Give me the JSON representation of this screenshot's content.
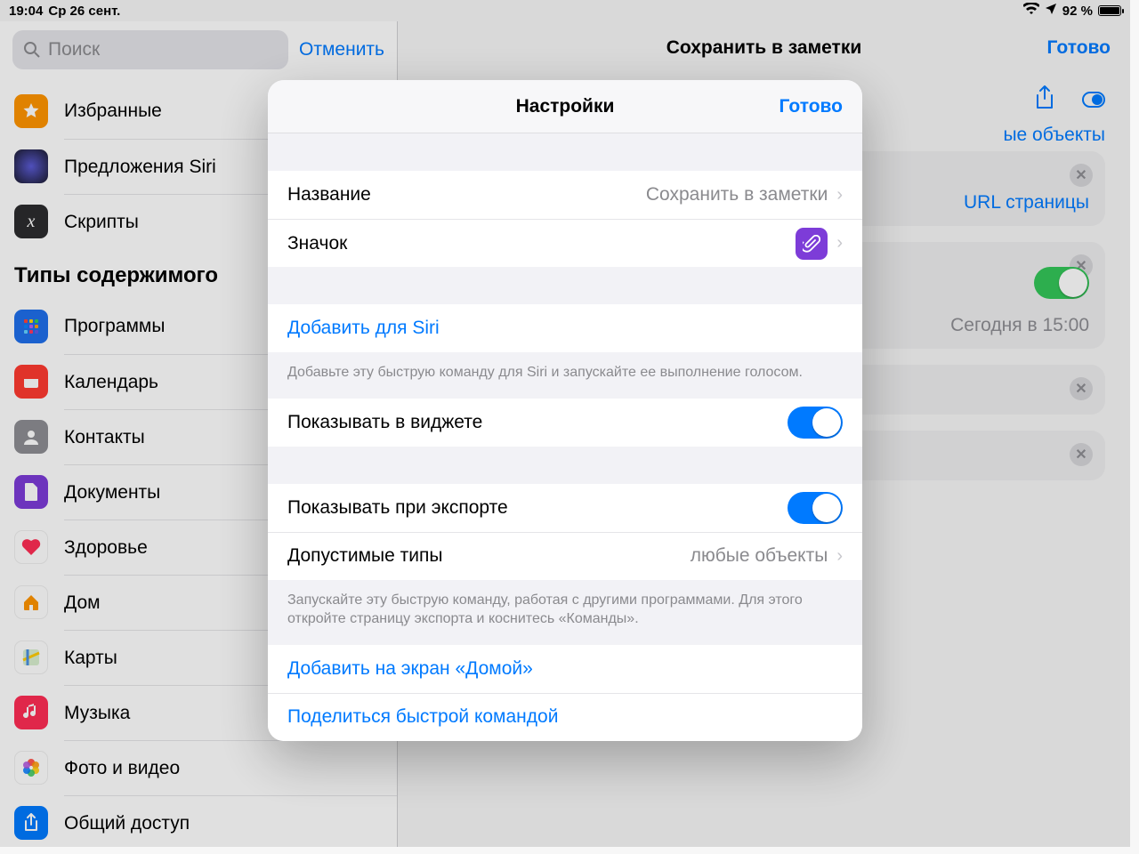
{
  "status": {
    "time": "19:04",
    "date": "Ср 26 сент.",
    "battery_pct": "92 %"
  },
  "sidebar": {
    "search_placeholder": "Поиск",
    "cancel": "Отменить",
    "top_items": [
      {
        "label": "Избранные"
      },
      {
        "label": "Предложения Siri"
      },
      {
        "label": "Скрипты"
      }
    ],
    "section_heading": "Типы содержимого",
    "type_items": [
      {
        "label": "Программы"
      },
      {
        "label": "Календарь"
      },
      {
        "label": "Контакты"
      },
      {
        "label": "Документы"
      },
      {
        "label": "Здоровье"
      },
      {
        "label": "Дом"
      },
      {
        "label": "Карты"
      },
      {
        "label": "Музыка"
      },
      {
        "label": "Фото и видео"
      },
      {
        "label": "Общий доступ"
      }
    ]
  },
  "main": {
    "title": "Сохранить в заметки",
    "done": "Готово",
    "accepts_label": "ые объекты",
    "url_label": "URL страницы",
    "timestamp": "Сегодня в 15:00"
  },
  "modal": {
    "title": "Настройки",
    "done": "Готово",
    "name_key": "Название",
    "name_val": "Сохранить в заметки",
    "icon_key": "Значок",
    "siri_add": "Добавить для Siri",
    "siri_note": "Добавьте эту быструю команду для Siri и запускайте ее выполнение голосом.",
    "widget_key": "Показывать в виджете",
    "export_key": "Показывать при экспорте",
    "types_key": "Допустимые типы",
    "types_val": "любые объекты",
    "export_note": "Запускайте эту быструю команду, работая с другими программами. Для этого откройте страницу экспорта и коснитесь «Команды».",
    "home_add": "Добавить на экран «Домой»",
    "share": "Поделиться быстрой командой"
  }
}
